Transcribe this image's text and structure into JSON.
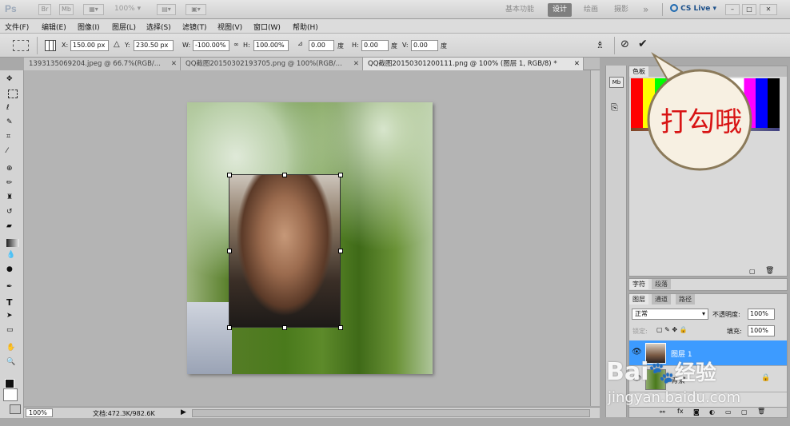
{
  "app": {
    "logo": "Ps",
    "zoom": "100%",
    "workspaces": [
      "基本功能",
      "设计",
      "绘画",
      "摄影"
    ],
    "active_workspace": "设计",
    "more": "»",
    "cs_live": "CS Live"
  },
  "menu": [
    "文件(F)",
    "编辑(E)",
    "图像(I)",
    "图层(L)",
    "选择(S)",
    "滤镜(T)",
    "视图(V)",
    "窗口(W)",
    "帮助(H)"
  ],
  "options": {
    "x_label": "X:",
    "x_value": "150.00 px",
    "y_label": "Y:",
    "y_value": "230.50 px",
    "w_label": "W:",
    "w_value": "-100.00%",
    "h_label": "H:",
    "h_value": "100.00%",
    "angle_value": "0.00",
    "angle_unit": "度",
    "hskew_label": "H:",
    "hskew_value": "0.00",
    "hskew_unit": "度",
    "vskew_label": "V:",
    "vskew_value": "0.00",
    "vskew_unit": "度"
  },
  "tabs": [
    {
      "label": "1393135069204.jpeg @ 66.7%(RGB/..."
    },
    {
      "label": "QQ截图20150302193705.png @ 100%(RGB/..."
    },
    {
      "label": "QQ截图20150301200111.png @ 100% (图层 1, RGB/8) *"
    }
  ],
  "status": {
    "zoom": "100%",
    "doc": "文档:472.3K/982.6K"
  },
  "swatches": {
    "tab_active": "色板",
    "colors_top": [
      "#ff0000",
      "#ffff00",
      "#00ff00",
      "#00ffff",
      "#0000ff",
      "#ff00ff",
      "#ffffff",
      "#000000"
    ]
  },
  "char_panel": {
    "tab1": "字符",
    "tab2": "段落"
  },
  "layers_panel": {
    "tabs": [
      "图层",
      "通道",
      "路径"
    ],
    "blend_mode": "正常",
    "opacity_label": "不透明度:",
    "opacity_value": "100%",
    "lock_label": "锁定:",
    "fill_label": "填充:",
    "fill_value": "100%",
    "layers": [
      {
        "name": "图层 1",
        "selected": true
      },
      {
        "name": "背景",
        "selected": false
      }
    ]
  },
  "callout": {
    "text": "打勾哦"
  },
  "watermark": {
    "brand": "Bai",
    "brand2": "经验",
    "url": "jingyan.baidu.com"
  }
}
